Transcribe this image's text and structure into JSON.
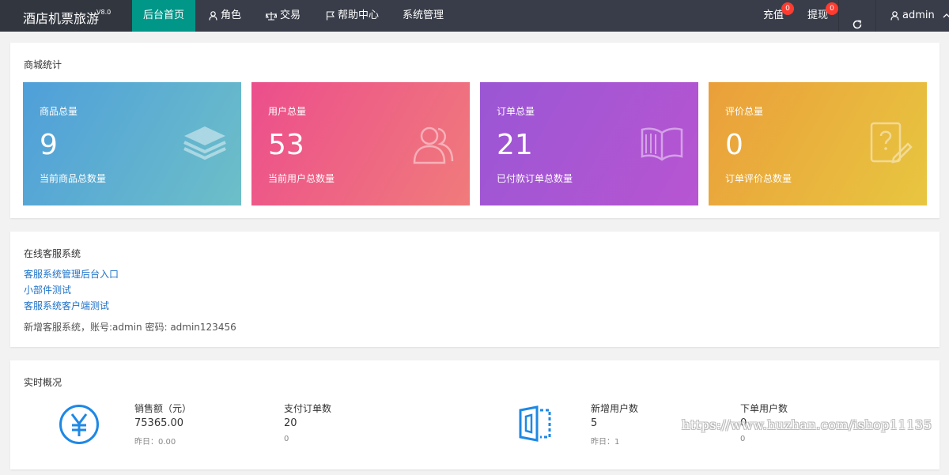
{
  "header": {
    "app_title": "酒店机票旅游",
    "version": "V8.0",
    "nav": [
      {
        "label": "后台首页",
        "icon": "",
        "active": true
      },
      {
        "label": "角色",
        "icon": "user-icon"
      },
      {
        "label": "交易",
        "icon": "scale-icon"
      },
      {
        "label": "帮助中心",
        "icon": "flag-icon"
      },
      {
        "label": "系统管理",
        "icon": ""
      }
    ],
    "recharge": {
      "label": "充值",
      "badge": "0"
    },
    "withdraw": {
      "label": "提现",
      "badge": "0"
    },
    "refresh_icon": "refresh-icon",
    "user": {
      "name": "admin",
      "icon": "user-icon",
      "caret_icon": "chevron-up-icon"
    }
  },
  "stats": {
    "title": "商城统计",
    "cards": [
      {
        "label": "商品总量",
        "value": "9",
        "sub": "当前商品总数量",
        "icon": "layers-icon",
        "gradient": [
          "#4f9fda",
          "#6dbfc8"
        ]
      },
      {
        "label": "用户总量",
        "value": "53",
        "sub": "当前用户总数量",
        "icon": "users-icon",
        "gradient": [
          "#ec4e8c",
          "#f07b7b"
        ]
      },
      {
        "label": "订单总量",
        "value": "21",
        "sub": "已付款订单总数量",
        "icon": "book-icon",
        "gradient": [
          "#9a56d4",
          "#b855d2"
        ]
      },
      {
        "label": "评价总量",
        "value": "0",
        "sub": "订单评价总数量",
        "icon": "edit-note-icon",
        "gradient": [
          "#ea9f3a",
          "#e8c640"
        ]
      }
    ]
  },
  "service": {
    "title": "在线客服系统",
    "links": [
      "客服系统管理后台入口",
      "小部件测试",
      "客服系统客户端测试"
    ],
    "note": "新增客服系统，账号:admin 密码: admin123456"
  },
  "realtime": {
    "title": "实时概况",
    "left_icon": "yen-icon",
    "right_icon": "door-icon",
    "items": [
      {
        "label": "销售额（元）",
        "value": "75365.00",
        "yesterday": "昨日：0.00"
      },
      {
        "label": "支付订单数",
        "value": "20",
        "yesterday": "0"
      },
      {
        "label": "新增用户数",
        "value": "5",
        "yesterday": "昨日：1"
      },
      {
        "label": "下单用户数",
        "value": "0",
        "yesterday": "0"
      }
    ]
  },
  "watermark": "https://www.huzhan.com/ishop11135"
}
